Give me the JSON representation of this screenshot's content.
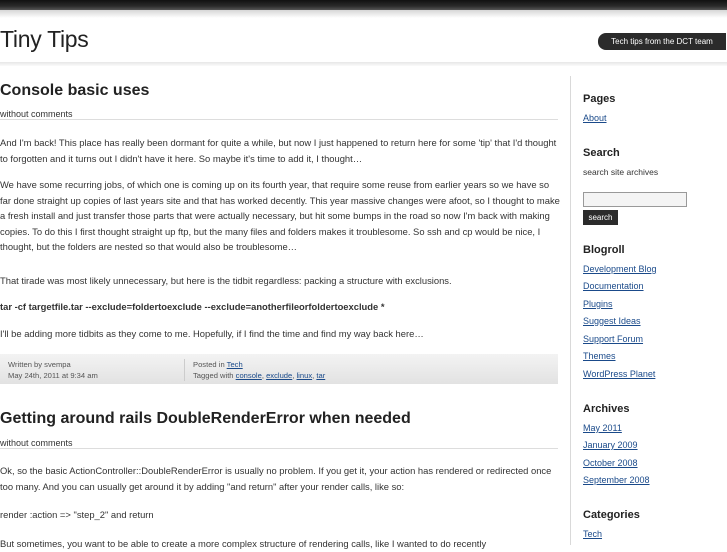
{
  "site": {
    "title": "Tiny Tips",
    "tagline": "Tech tips from the DCT team"
  },
  "posts": [
    {
      "title": "Console basic uses",
      "meta": "without comments",
      "paragraphs": [
        "And I'm back! This place has really been dormant for quite a while, but now I just happened to return here for some 'tip' that I'd thought to forgotten and it turns out I didn't have it here. So maybe it's time to add it, I thought…",
        "We have some recurring jobs, of which one is coming up on its fourth year, that require some reuse from earlier years so we have so far done straight up copies of last years site and that has worked decently. This year massive changes were afoot, so I thought to make a fresh install and just transfer those parts that were actually necessary, but hit some bumps in the road so now I'm back with making copies. To do this I first thought straight up ftp, but the many files and folders makes it troublesome. So ssh and cp would be nice, I thought, but the folders are nested so that would also be troublesome…",
        "That tirade was most likely unnecessary, but here is the tidbit regardless: packing a structure with exclusions.",
        "tar -cf targetfile.tar --exclude=foldertoexclude --exclude=anotherfileorfoldertoexclude *",
        "I'll be adding more tidbits as they come to me. Hopefully, if I find the time and find my way back here…"
      ],
      "footer": {
        "written_by": "Written by svempa",
        "date": "May 24th, 2011 at 9:34 am",
        "posted_in_label": "Posted in",
        "category": "Tech",
        "tagged_label": "Tagged with",
        "tags": [
          "console",
          "exclude",
          "linux",
          "tar"
        ]
      }
    },
    {
      "title": "Getting around rails DoubleRenderError when needed",
      "meta": "without comments",
      "paragraphs": [
        "Ok, so the basic ActionController::DoubleRenderError is usually no problem. If you get it, your action has rendered or redirected once too many. And you can usually get around it by adding \"and return\" after your render calls, like so:",
        "render :action => \"step_2\" and return",
        "But sometimes, you want to be able to create a more complex structure of rendering calls, like I wanted to do recently"
      ]
    }
  ],
  "sidebar": {
    "pages_heading": "Pages",
    "pages": [
      "About"
    ],
    "search_heading": "Search",
    "search_text": "search site archives",
    "search_value": "",
    "search_button": "search",
    "blogroll_heading": "Blogroll",
    "blogroll": [
      "Development Blog",
      "Documentation",
      "Plugins",
      "Suggest Ideas",
      "Support Forum",
      "Themes",
      "WordPress Planet"
    ],
    "archives_heading": "Archives",
    "archives": [
      "May 2011",
      "January 2009",
      "October 2008",
      "September 2008"
    ],
    "categories_heading": "Categories",
    "categories": [
      "Tech"
    ]
  }
}
